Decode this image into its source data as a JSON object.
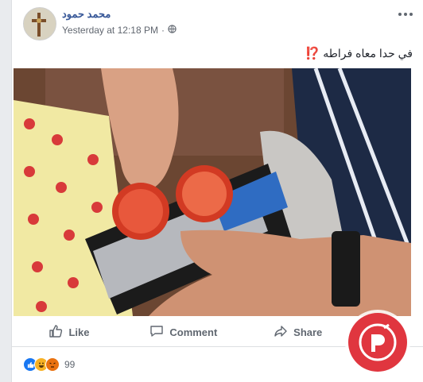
{
  "post": {
    "author": "محمد حمود",
    "timestamp": "Yesterday at 12:18 PM",
    "separator": "·",
    "privacy_icon": "globe-icon",
    "text": "في حدا معاه فراطه",
    "text_emoji": "⁉️"
  },
  "actions": {
    "like_label": "Like",
    "comment_label": "Comment",
    "share_label": "Share"
  },
  "reactions": {
    "types": [
      "like",
      "haha",
      "angry"
    ],
    "count": "99"
  },
  "colors": {
    "author_link": "#385898",
    "action_text": "#606770",
    "like_blue": "#1877f2",
    "watermark_red": "#e0363f"
  }
}
